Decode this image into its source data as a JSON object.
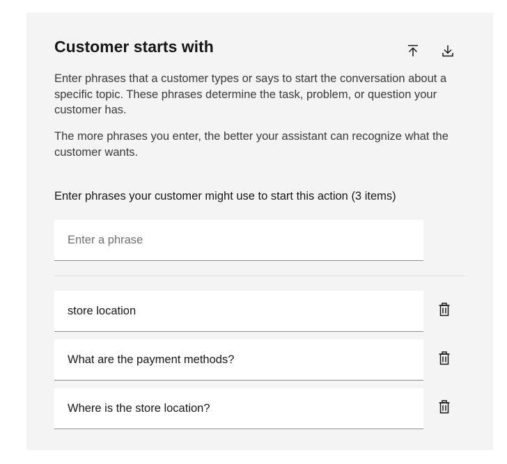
{
  "section": {
    "title": "Customer starts with",
    "description_1": "Enter phrases that a customer types or says to start the conversation about a specific topic. These phrases determine the task, problem, or question your customer has.",
    "description_2": "The more phrases you enter, the better your assistant can recognize what the customer wants."
  },
  "toolbar": {
    "upload_icon": "upload-icon",
    "download_icon": "download-icon"
  },
  "phrases": {
    "label": "Enter phrases your customer might use to start this action (3 items)",
    "placeholder": "Enter a phrase",
    "new_value": "",
    "items": [
      {
        "value": "store location",
        "delete_icon": "trash-icon"
      },
      {
        "value": "What are the payment methods?",
        "delete_icon": "trash-icon"
      },
      {
        "value": "Where is the store location?",
        "delete_icon": "trash-icon"
      }
    ]
  },
  "colors": {
    "panel_background": "#f4f4f4",
    "input_background": "#ffffff",
    "input_border": "#8d8d8d",
    "text_primary": "#161616",
    "text_secondary": "#393939",
    "placeholder": "#6f6f6f"
  }
}
